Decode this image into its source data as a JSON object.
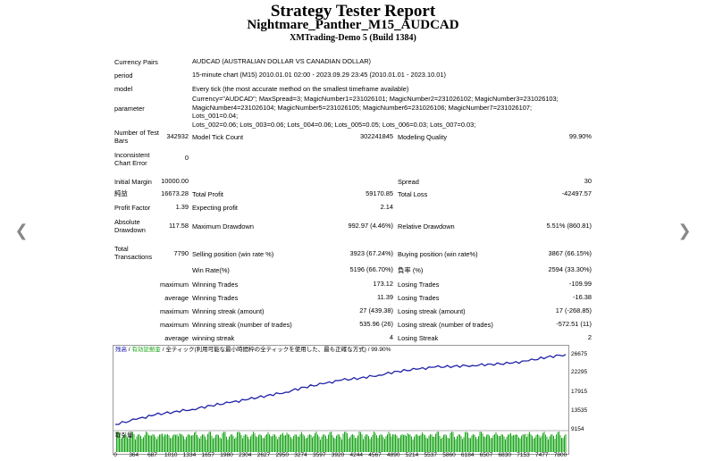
{
  "header": {
    "title": "Strategy Tester Report",
    "ea_name": "Nightmare_Panther_M15_AUDCAD",
    "server": "XMTrading-Demo 5 (Build 1384)"
  },
  "settings": {
    "currency_pairs_label": "Currency Pairs",
    "currency_pairs": "AUDCAD (AUSTRALIAN DOLLAR VS CANADIAN DOLLAR)",
    "period_label": "period",
    "period": "15-minute chart (M15) 2010.01.01 02:00 - 2023.09.29 23:45 (2010.01.01 - 2023.10.01)",
    "model_label": "model",
    "model": "Every tick (the most accurate method on the smallest timeframe available)",
    "parameter_label": "parameter",
    "parameter_lines": [
      "Currency=\"AUDCAD\"; MaxSpread=3; MagicNumber1=231026101; MagicNumber2=231026102; MagicNumber3=231026103;",
      "MagicNumber4=231026104; MagicNumber5=231026105; MagicNumber6=231026106; MagicNumber7=231026107; Lots_001=0.04;",
      "Lots_002=0.06; Lots_003=0.06; Lots_004=0.06; Lots_005=0.05; Lots_006=0.03; Lots_007=0.03;"
    ]
  },
  "stats": {
    "test_bars_label": "Number of Test Bars",
    "test_bars": "342932",
    "model_tick_count_label": "Model Tick Count",
    "model_tick_count": "302241845",
    "modeling_quality_label": "Modeling Quality",
    "modeling_quality": "99.90%",
    "inconsistent_label": "Inconsistent Chart Error",
    "inconsistent": "0",
    "initial_margin_label": "Initial Margin",
    "initial_margin": "10000.00",
    "spread_label": "Spread",
    "spread": "30",
    "net_profit_label": "純益",
    "net_profit": "16673.28",
    "total_profit_label": "Total Profit",
    "total_profit": "59170.85",
    "total_loss_label": "Total Loss",
    "total_loss": "-42497.57",
    "profit_factor_label": "Profit Factor",
    "profit_factor": "1.39",
    "expected_profit_label": "Expecting profit",
    "expected_profit": "2.14",
    "absolute_dd_label": "Absolute Drawdown",
    "absolute_dd": "117.58",
    "maximum_dd_label": "Maximum Drawdown",
    "maximum_dd": "992.97 (4.46%)",
    "relative_dd_label": "Relative Drawdown",
    "relative_dd": "5.51% (860.81)",
    "total_transactions_label": "Total Transactions",
    "total_transactions": "7790",
    "selling_label": "Selling position (win rate %)",
    "selling": "3923 (67.24%)",
    "buying_label": "Buying position (win rate%)",
    "buying": "3867 (66.15%)",
    "win_rate_label": "Win Rate(%)",
    "win_rate": "5196 (66.70%)",
    "loss_rate_label": "負率 (%)",
    "loss_rate": "2594 (33.30%)",
    "max_label": "maximum",
    "avg_label": "average",
    "winning_trades_label": "Winning Trades",
    "max_winning_trade": "173.12",
    "losing_trades_label": "Losing Trades",
    "max_losing_trade": "-109.99",
    "avg_winning_trade": "11.39",
    "avg_losing_trade": "-16.38",
    "win_streak_amount_label": "Winning streak (amount)",
    "win_streak_amount": "27 (439.38)",
    "loss_streak_amount_label": "Losing streak (amount)",
    "loss_streak_amount": "17 (-268.85)",
    "win_streak_trades_label": "Winning streak (number of trades)",
    "win_streak_trades": "535.96 (26)",
    "loss_streak_trades_label": "Losing streak (number of trades)",
    "loss_streak_trades": "-572.51 (11)",
    "avg_win_streak_label": "winning streak",
    "avg_win_streak": "4",
    "avg_loss_streak_label": "Losing Streak",
    "avg_loss_streak": "2"
  },
  "chart": {
    "legend_balance": "残高",
    "legend_sep1": " / ",
    "legend_equity": "有効証拠金",
    "legend_rest": " / 全ティック(利用可能な最小時間枠の全ティックを使用した、最も正確な方式) / 99.90%",
    "volume_label": "取引量",
    "line_color": "#1e20a8",
    "volume_color": "#1aa51a",
    "yticks": [
      "26675",
      "22295",
      "17915",
      "13535",
      "9154"
    ],
    "xticks": [
      "0",
      "364",
      "687",
      "1010",
      "1334",
      "1657",
      "1980",
      "2304",
      "2627",
      "2950",
      "3274",
      "3597",
      "3920",
      "4244",
      "4567",
      "4890",
      "5214",
      "5537",
      "5860",
      "6184",
      "6507",
      "6830",
      "7153",
      "7477",
      "7800"
    ]
  },
  "chart_data": {
    "type": "line",
    "title": "",
    "xlabel": "",
    "ylabel": "",
    "ylim": [
      9154,
      26675
    ],
    "xlim": [
      0,
      7800
    ],
    "series": [
      {
        "name": "残高",
        "x": [
          0,
          364,
          687,
          1010,
          1334,
          1657,
          1980,
          2304,
          2627,
          2950,
          3274,
          3597,
          3920,
          4244,
          4567,
          4890,
          5214,
          5537,
          5860,
          6184,
          6507,
          6830,
          7153,
          7477,
          7800
        ],
        "values": [
          10000,
          11200,
          12300,
          13000,
          13600,
          14500,
          15200,
          16000,
          16900,
          17700,
          18900,
          19700,
          20600,
          21100,
          21800,
          22700,
          23200,
          23700,
          23900,
          24100,
          24400,
          24600,
          25200,
          26100,
          26700
        ]
      }
    ]
  }
}
